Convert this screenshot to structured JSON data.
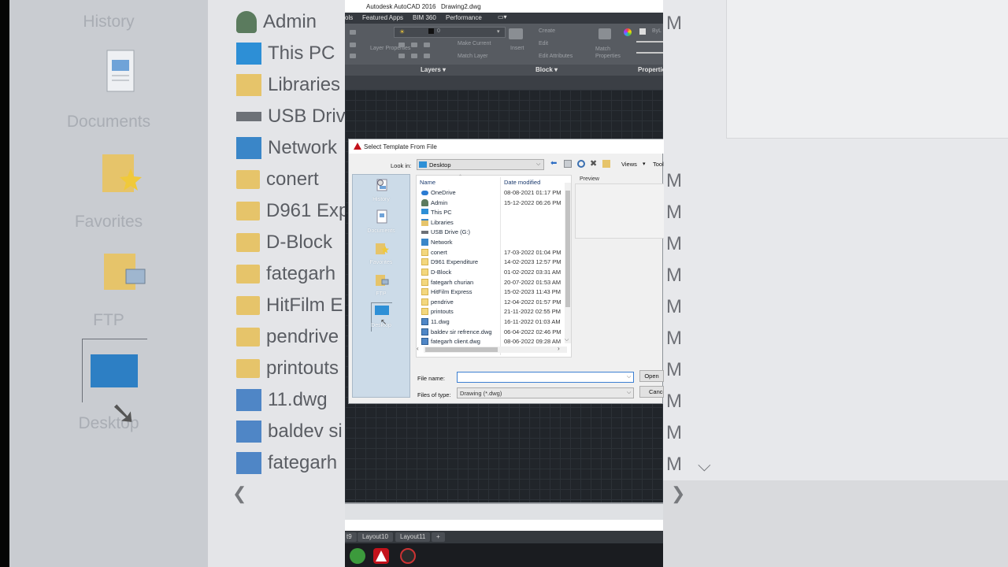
{
  "background": {
    "sidebar_places": [
      "History",
      "Documents",
      "Favorites",
      "FTP",
      "Desktop"
    ],
    "list_items": [
      {
        "label": "Admin",
        "icon": "user-icon"
      },
      {
        "label": "This PC",
        "icon": "monitor-icon"
      },
      {
        "label": "Libraries",
        "icon": "libraries-icon"
      },
      {
        "label": "USB Drive",
        "icon": "usb-drive-icon"
      },
      {
        "label": "Network",
        "icon": "network-icon"
      },
      {
        "label": "conert",
        "icon": "folder-icon"
      },
      {
        "label": "D961 Exp",
        "icon": "folder-icon"
      },
      {
        "label": "D-Block",
        "icon": "folder-icon"
      },
      {
        "label": "fategarh",
        "icon": "folder-icon"
      },
      {
        "label": "HitFilm E",
        "icon": "folder-icon"
      },
      {
        "label": "pendrive",
        "icon": "folder-icon"
      },
      {
        "label": "printouts",
        "icon": "folder-icon"
      },
      {
        "label": "11.dwg",
        "icon": "dwg-icon"
      },
      {
        "label": "baldev si",
        "icon": "dwg-icon"
      },
      {
        "label": "fategarh",
        "icon": "dwg-icon"
      }
    ],
    "right_m": [
      "M",
      "M",
      "M",
      "M",
      "M",
      "M",
      "M",
      "M",
      "M",
      "M",
      "M",
      "M",
      "M",
      "M",
      "M"
    ]
  },
  "autocad": {
    "title": "Autodesk AutoCAD 2016",
    "document": "Drawing2.dwg",
    "menu": [
      "ols",
      "Featured Apps",
      "BIM 360",
      "Performance"
    ],
    "ribbon": {
      "layer_value": "0",
      "make_current": "Make Current",
      "match_layer": "Match Layer",
      "layer_properties": "Layer Properties",
      "insert": "Insert",
      "create": "Create",
      "edit": "Edit",
      "edit_attributes": "Edit Attributes",
      "match_properties": "Match Properties",
      "bylayer": "ByL",
      "panels": [
        "Layers",
        "Block",
        "Propertie"
      ]
    },
    "layout_tabs": [
      "t9",
      "Layout10",
      "Layout11",
      "+"
    ]
  },
  "dialog": {
    "title": "Select Template From File",
    "look_in_label": "Look in:",
    "look_in_value": "Desktop",
    "views_label": "Views",
    "tools_label": "Tools",
    "places": [
      "History",
      "Documents",
      "Favorites",
      "FTP",
      "Desktop"
    ],
    "columns": {
      "name": "Name",
      "date": "Date modified"
    },
    "files": [
      {
        "name": "OneDrive",
        "date": "08-08-2021 01:17 PM",
        "icon": "onedrive-icon"
      },
      {
        "name": "Admin",
        "date": "15-12-2022 06:26 PM",
        "icon": "user-icon"
      },
      {
        "name": "This PC",
        "date": "",
        "icon": "monitor-icon"
      },
      {
        "name": "Libraries",
        "date": "",
        "icon": "libraries-icon"
      },
      {
        "name": "USB Drive (G:)",
        "date": "",
        "icon": "usb-drive-icon"
      },
      {
        "name": "Network",
        "date": "",
        "icon": "network-icon"
      },
      {
        "name": "conert",
        "date": "17-03-2022 01:04 PM",
        "icon": "folder-icon"
      },
      {
        "name": "D961 Expenditure",
        "date": "14-02-2023 12:57 PM",
        "icon": "folder-icon"
      },
      {
        "name": "D-Block",
        "date": "01-02-2022 03:31 AM",
        "icon": "folder-icon"
      },
      {
        "name": "fategarh churian",
        "date": "20-07-2022 01:53 AM",
        "icon": "folder-icon"
      },
      {
        "name": "HitFilm Express",
        "date": "15-02-2023 11:43 PM",
        "icon": "folder-icon"
      },
      {
        "name": "pendrive",
        "date": "12-04-2022 01:57 PM",
        "icon": "folder-icon"
      },
      {
        "name": "printouts",
        "date": "21-11-2022 02:55 PM",
        "icon": "folder-icon"
      },
      {
        "name": "11.dwg",
        "date": "16-11-2022 01:03 AM",
        "icon": "dwg-icon"
      },
      {
        "name": "baldev sir refrence.dwg",
        "date": "06-04-2022 02:46 PM",
        "icon": "dwg-icon"
      },
      {
        "name": "fategarh client.dwg",
        "date": "08-06-2022 09:28 AM",
        "icon": "dwg-icon"
      }
    ],
    "preview_label": "Preview",
    "file_name_label": "File name:",
    "file_name_value": "",
    "files_of_type_label": "Files of type:",
    "files_of_type_value": "Drawing (*.dwg)",
    "open_label": "Open",
    "cancel_label": "Cance"
  }
}
